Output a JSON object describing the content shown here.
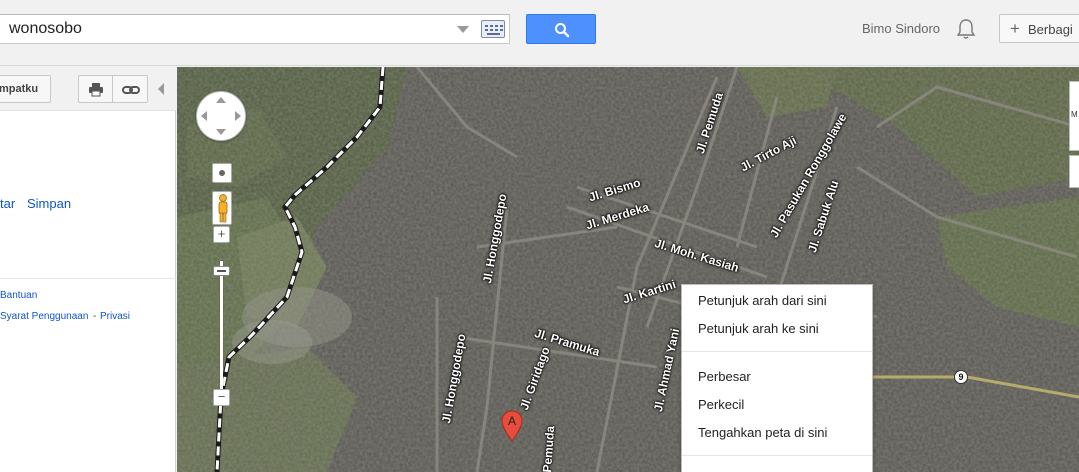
{
  "search": {
    "value": "wonosobo"
  },
  "header": {
    "user_name": "Bimo Sindoro",
    "share_label": "Berbagi",
    "share_icon": "plus"
  },
  "left_panel": {
    "places_button_label": "mpatku",
    "link_left": "tar",
    "link_save": "Simpan",
    "help_link": "Bantuan",
    "terms_link": "Syarat Penggunaan",
    "separator": "-",
    "privacy_link": "Privasi"
  },
  "map": {
    "type": "satellite",
    "marker_label": "A",
    "route_badge": "9",
    "streets": {
      "pemuda": "Jl. Pemuda",
      "tirto_aji": "Jl. Tirto Aji",
      "pasukan_ronggolawe": "Jl. Pasukan Ronggolawe",
      "sabuk_alu": "Jl. Sabuk Alu",
      "bismo": "Jl. Bismo",
      "merdeka": "Jl. Merdeka",
      "moh_kasiah": "Jl. Moh. Kasiah",
      "honggodepo_1": "Jl. Honggodepo",
      "kartini": "Jl. Kartini",
      "pramuka": "Jl. Pramuka",
      "ahmad_yani": "Jl. Ahmad Yani",
      "honggodepo_2": "Jl. Honggodepo",
      "giridago": "Jl. Giridago",
      "pemuda_2": "Pemuda"
    },
    "edge_text": "M"
  },
  "context_menu": {
    "items": [
      "Petunjuk arah dari sini",
      "Petunjuk arah ke sini",
      "Perbesar",
      "Perkecil",
      "Tengahkan peta di sini"
    ]
  },
  "colors": {
    "search_button": "#4d90fe",
    "link": "#1155cc",
    "marker": "#e74c3c"
  }
}
